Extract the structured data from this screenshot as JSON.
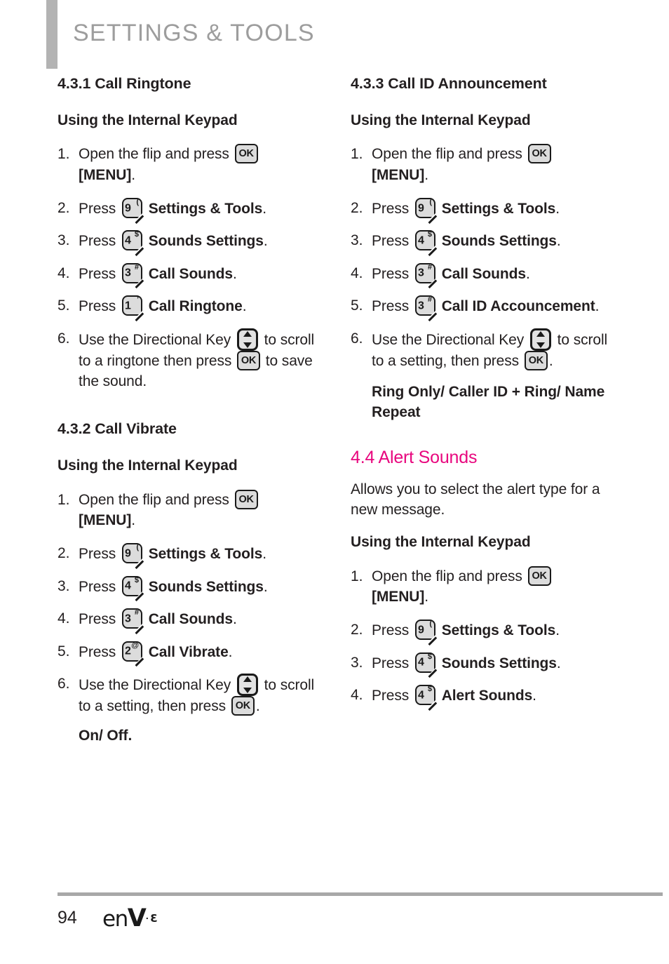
{
  "header": {
    "title": "SETTINGS & TOOLS",
    "bar_color": "#b3b3b3",
    "title_color": "#9d9d9d"
  },
  "theme": {
    "accent_pink": "#e8077e",
    "text": "#231f20",
    "rule_gray": "#a8a8a8",
    "key_fill": "#dcdcdc",
    "key_border": "#1a1a1a"
  },
  "keys": {
    "ok_label": "OK",
    "digit_1": "1",
    "sup_1": "’",
    "digit_2": "2",
    "sup_2": "@",
    "digit_3": "3",
    "sup_3": "#",
    "digit_4": "4",
    "sup_4": "$",
    "digit_9": "9",
    "sup_9": "("
  },
  "left_column": {
    "section_431": {
      "heading": "4.3.1 Call Ringtone",
      "keypad_heading": "Using the Internal Keypad",
      "steps": [
        {
          "num": "1.",
          "text_before_key": "Open the flip and press",
          "key": "ok",
          "text_after_key": "",
          "bold_tail": "[MENU]",
          "period": "."
        },
        {
          "num": "2.",
          "text_before_key": "Press",
          "key": "9",
          "bold_tail": "Settings & Tools",
          "period": "."
        },
        {
          "num": "3.",
          "text_before_key": "Press",
          "key": "4",
          "bold_tail": "Sounds Settings",
          "period": "."
        },
        {
          "num": "4.",
          "text_before_key": "Press",
          "key": "3",
          "bold_tail": "Call Sounds",
          "period": "."
        },
        {
          "num": "5.",
          "text_before_key": "Press",
          "key": "1",
          "bold_tail": "Call Ringtone",
          "period": "."
        },
        {
          "num": "6.",
          "text_before_key": "Use the Directional Key",
          "key": "dir",
          "text_after_key": "to scroll to a ringtone then press",
          "key2": "ok",
          "text_tail": "to save the sound."
        }
      ]
    },
    "section_432": {
      "heading": "4.3.2 Call Vibrate",
      "keypad_heading": "Using the Internal Keypad",
      "steps": [
        {
          "num": "1.",
          "text_before_key": "Open the flip and press",
          "key": "ok",
          "bold_tail": "[MENU]",
          "period": "."
        },
        {
          "num": "2.",
          "text_before_key": "Press",
          "key": "9",
          "bold_tail": "Settings & Tools",
          "period": "."
        },
        {
          "num": "3.",
          "text_before_key": "Press",
          "key": "4",
          "bold_tail": "Sounds Settings",
          "period": "."
        },
        {
          "num": "4.",
          "text_before_key": "Press",
          "key": "3",
          "bold_tail": "Call Sounds",
          "period": "."
        },
        {
          "num": "5.",
          "text_before_key": "Press",
          "key": "2",
          "bold_tail": "Call Vibrate",
          "period": "."
        },
        {
          "num": "6.",
          "text_before_key": "Use the Directional Key",
          "key": "dir",
          "text_after_key": "to scroll to a setting, then press",
          "key2": "ok",
          "text_tail": "."
        }
      ],
      "options_note": "On/ Off."
    }
  },
  "right_column": {
    "section_433": {
      "heading": "4.3.3 Call ID Announcement",
      "keypad_heading": "Using the Internal Keypad",
      "steps": [
        {
          "num": "1.",
          "text_before_key": "Open the flip and press",
          "key": "ok",
          "bold_tail": "[MENU]",
          "period": "."
        },
        {
          "num": "2.",
          "text_before_key": "Press",
          "key": "9",
          "bold_tail": "Settings & Tools",
          "period": "."
        },
        {
          "num": "3.",
          "text_before_key": "Press",
          "key": "4",
          "bold_tail": "Sounds Settings",
          "period": "."
        },
        {
          "num": "4.",
          "text_before_key": "Press",
          "key": "3",
          "bold_tail": "Call Sounds",
          "period": "."
        },
        {
          "num": "5.",
          "text_before_key": "Press",
          "key": "3",
          "bold_tail": "Call ID Accouncement",
          "period": "."
        },
        {
          "num": "6.",
          "text_before_key": "Use the Directional Key",
          "key": "dir",
          "text_after_key": "to scroll to a setting, then press",
          "key2": "ok",
          "text_tail": "."
        }
      ],
      "options_note": "Ring Only/ Caller ID + Ring/ Name Repeat"
    },
    "section_44": {
      "heading": "4.4 Alert Sounds",
      "description": "Allows you to select the alert type for a new message.",
      "keypad_heading": "Using the Internal Keypad",
      "steps": [
        {
          "num": "1.",
          "text_before_key": "Open the flip and press",
          "key": "ok",
          "bold_tail": "[MENU]",
          "period": "."
        },
        {
          "num": "2.",
          "text_before_key": "Press",
          "key": "9",
          "bold_tail": "Settings & Tools",
          "period": "."
        },
        {
          "num": "3.",
          "text_before_key": "Press",
          "key": "4",
          "bold_tail": "Sounds Settings",
          "period": "."
        },
        {
          "num": "4.",
          "text_before_key": "Press",
          "key": "4",
          "bold_tail": "Alert Sounds",
          "period": "."
        }
      ]
    }
  },
  "footer": {
    "page_number": "94",
    "logo_en": "en",
    "logo_v": "V",
    "logo_dot": "·",
    "logo_sup": "3"
  }
}
